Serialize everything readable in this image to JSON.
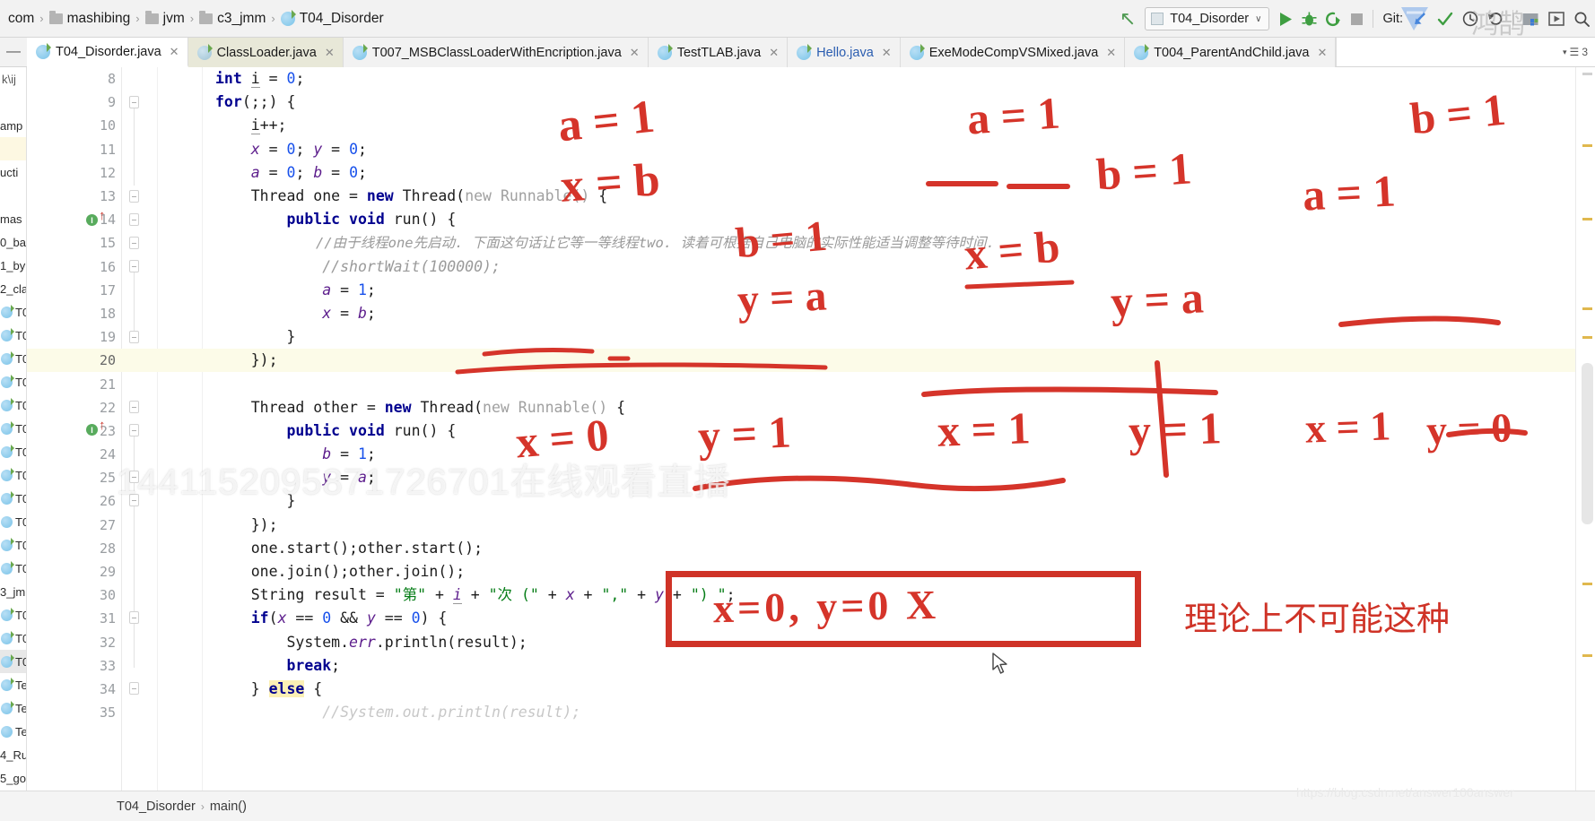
{
  "window": {
    "breadcrumb": [
      {
        "label": "com",
        "icon": "none"
      },
      {
        "label": "mashibing",
        "icon": "folder-icon"
      },
      {
        "label": "jvm",
        "icon": "folder-icon"
      },
      {
        "label": "c3_jmm",
        "icon": "folder-icon"
      },
      {
        "label": "T04_Disorder",
        "icon": "java-class-icon"
      }
    ]
  },
  "toolbar": {
    "back_arrow": "↖",
    "run_config": "T04_Disorder",
    "run_label": "Run",
    "debug_label": "Debug",
    "run_coverage_label": "Run with Coverage",
    "stop_label": "Stop",
    "git_label": "Git:",
    "update_project_label": "Update Project",
    "commit_label": "Commit",
    "history_label": "History",
    "revert_label": "Revert",
    "chevron": "∨"
  },
  "tabs": [
    {
      "label": "T04_Disorder.java",
      "state": "active"
    },
    {
      "label": "ClassLoader.java",
      "state": "highlighted"
    },
    {
      "label": "T007_MSBClassLoaderWithEncription.java",
      "state": "normal"
    },
    {
      "label": "TestTLAB.java",
      "state": "normal"
    },
    {
      "label": "Hello.java",
      "state": "normal"
    },
    {
      "label": "ExeModeCompVSMixed.java",
      "state": "normal"
    },
    {
      "label": "T004_ParentAndChild.java",
      "state": "normal"
    }
  ],
  "tabs_overflow": "3",
  "project_strip": [
    "k\\ij",
    "",
    "amp",
    "",
    "ucti",
    "",
    "mas",
    "0_ba",
    "1_by",
    "2_cla",
    "T0",
    "T0",
    "T0",
    "T0",
    "T0",
    "T0",
    "T0",
    "T0",
    "T0",
    "T0",
    "T0",
    "T0",
    "3_jm",
    "T0",
    "T0",
    "T0",
    "Te",
    "Te",
    "Te",
    "4_Ru",
    "5_go"
  ],
  "editor": {
    "first_line": 8,
    "lines": [
      {
        "n": 8,
        "text": "int i = 0;"
      },
      {
        "n": 9,
        "text": "for(;;) {"
      },
      {
        "n": 10,
        "text": "    i++;"
      },
      {
        "n": 11,
        "text": "    x = 0; y = 0;"
      },
      {
        "n": 12,
        "text": "    a = 0; b = 0;"
      },
      {
        "n": 13,
        "text": "    Thread one = new Thread(new Runnable() {"
      },
      {
        "n": 14,
        "text": "        public void run() {"
      },
      {
        "n": 15,
        "text": "            //由于线程one先启动. 下面这句话让它等一等线程two. 读着可根据自己电脑的实际性能适当调整等待时间."
      },
      {
        "n": 16,
        "text": "            //shortWait(100000);"
      },
      {
        "n": 17,
        "text": "            a = 1;"
      },
      {
        "n": 18,
        "text": "            x = b;"
      },
      {
        "n": 19,
        "text": "        }"
      },
      {
        "n": 20,
        "text": "    });"
      },
      {
        "n": 21,
        "text": ""
      },
      {
        "n": 22,
        "text": "    Thread other = new Thread(new Runnable() {"
      },
      {
        "n": 23,
        "text": "        public void run() {"
      },
      {
        "n": 24,
        "text": "            b = 1;"
      },
      {
        "n": 25,
        "text": "            y = a;"
      },
      {
        "n": 26,
        "text": "        }"
      },
      {
        "n": 27,
        "text": "    });"
      },
      {
        "n": 28,
        "text": "    one.start();other.start();"
      },
      {
        "n": 29,
        "text": "    one.join();other.join();"
      },
      {
        "n": 30,
        "text": "    String result = \"第\" + i + \"次 (\" + x + \",\" + y + \") \";"
      },
      {
        "n": 31,
        "text": "    if(x == 0 && y == 0) {"
      },
      {
        "n": 32,
        "text": "        System.err.println(result);"
      },
      {
        "n": 33,
        "text": "        break;"
      },
      {
        "n": 34,
        "text": "    } else {"
      },
      {
        "n": 35,
        "text": "        //System.out.println(result);"
      }
    ],
    "highlighted_line": 20,
    "breakpoint_lines": [
      14,
      23
    ]
  },
  "status": {
    "class_name": "T04_Disorder",
    "separator": "›",
    "method_name": "main()"
  },
  "annotations": {
    "group1": [
      "a = 1",
      "x = b",
      "b = 1",
      "y = a",
      "x = 0",
      "y = 1"
    ],
    "group2": [
      "a = 1",
      "b = 1",
      "x = b",
      "y = a",
      "x = 1",
      "y = 1"
    ],
    "group3": [
      "b = 1",
      "a = 1",
      "x = 1",
      "y = 0"
    ],
    "boxed_case": "x=0, y=0   X",
    "chinese_note": "理论上不可能这种"
  },
  "watermarks": {
    "live_text": "1441152095871726701在线观看直播",
    "logo_text": "鸿鹄",
    "url": "https://blog.csdn.net/answer100answer"
  },
  "colors": {
    "annotation_red": "#d5342a",
    "box_red": "#cf3327",
    "keyword_blue": "#00008f",
    "number_blue": "#1750eb",
    "field_purple": "#5c1d8c",
    "comment_grey": "#9a9a9a",
    "string_green": "#067d17",
    "highlight_yellow": "#fcfbe8"
  }
}
